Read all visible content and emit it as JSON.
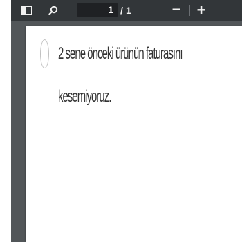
{
  "toolbar": {
    "icons": {
      "sidebar": "sidebar-toggle-icon",
      "search": "search-icon"
    },
    "page_current": "1",
    "page_separator": "/",
    "page_total": "1",
    "zoom_out_label": "−",
    "zoom_in_label": "+"
  },
  "document": {
    "question_line_1": "2 sene önceki ürünün faturasını",
    "question_line_2": "kesemiyoruz."
  },
  "colors": {
    "toolbar_bg": "#323639",
    "viewer_bg": "#525659",
    "page_bg": "#ffffff",
    "text": "#333333"
  }
}
